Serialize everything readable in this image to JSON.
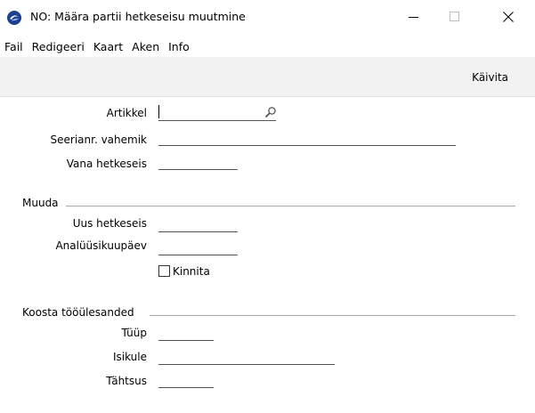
{
  "window": {
    "title": "NO: Määra partii hetkeseisu muutmine"
  },
  "menu": [
    "Fail",
    "Redigeeri",
    "Kaart",
    "Aken",
    "Info"
  ],
  "toolbar": {
    "run_label": "Käivita"
  },
  "form": {
    "artikkel_label": "Artikkel",
    "seerianr_label": "Seerianr. vahemik",
    "vana_label": "Vana hetkeseis",
    "muuda_section": "Muuda",
    "uus_label": "Uus hetkeseis",
    "analuusi_label": "Analüüsikuupäev",
    "kinnita_label": "Kinnita",
    "koosta_section": "Koosta tööülesanded",
    "tuup_label": "Tüüp",
    "isikule_label": "Isikule",
    "tahtsus_label": "Tähtsus"
  }
}
